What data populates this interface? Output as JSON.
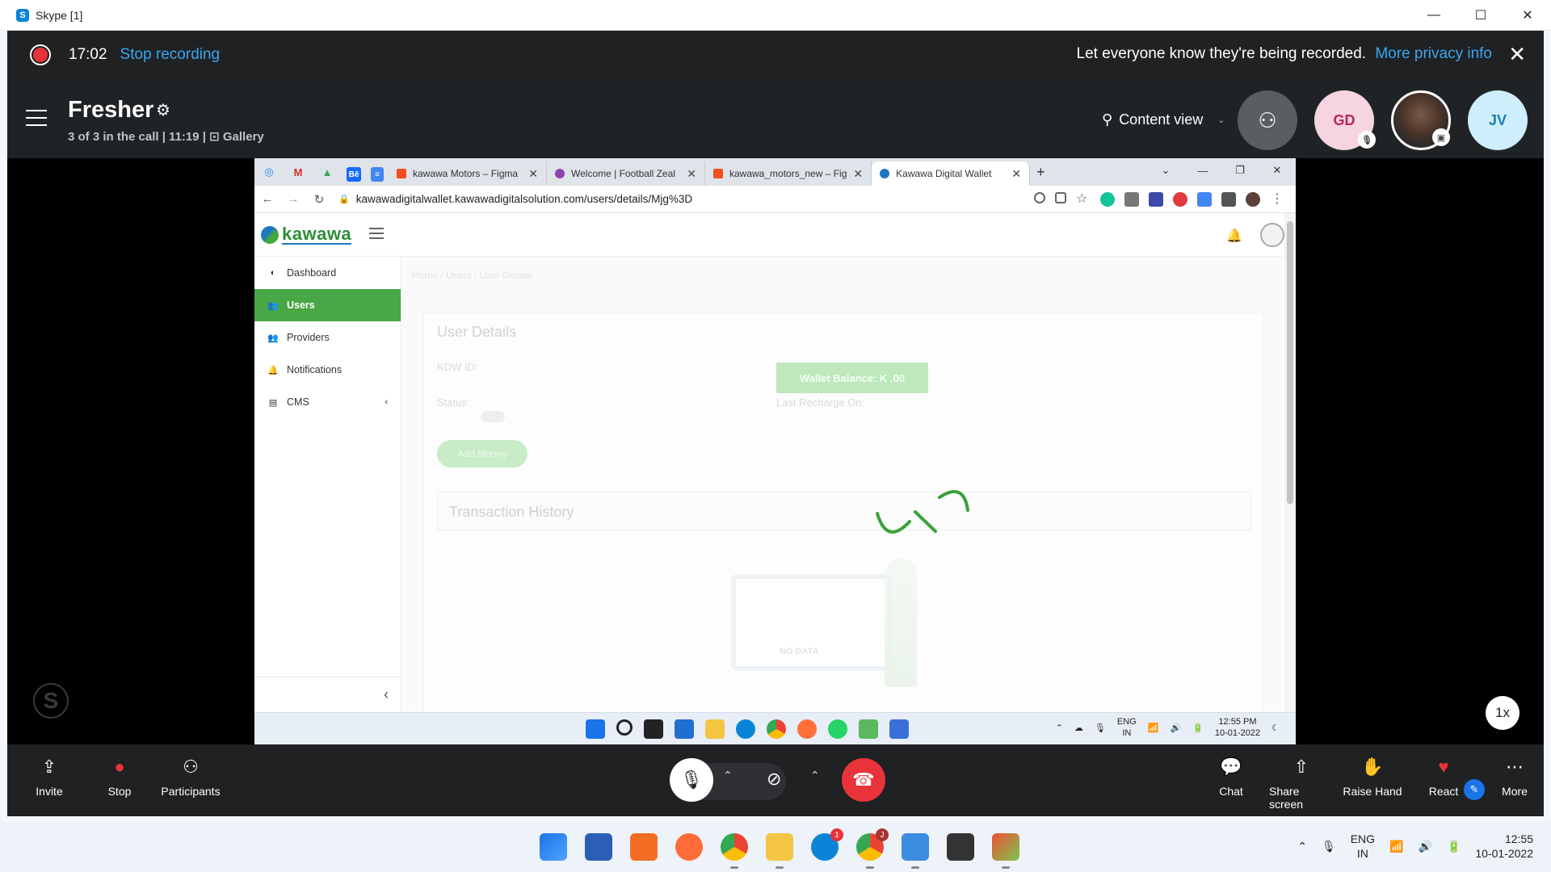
{
  "window": {
    "title": "Skype [1]",
    "minimize": "—",
    "maximize": "☐",
    "close": "✕"
  },
  "recording": {
    "time": "17:02",
    "stop_label": "Stop recording",
    "message": "Let everyone know they're being recorded.",
    "privacy_link": "More privacy info",
    "close": "✕"
  },
  "call": {
    "name": "Fresher",
    "subtitle": "3 of 3 in the call | 11:19 | ⊡ Gallery",
    "content_view": "Content view",
    "participants": [
      {
        "initials": "GD",
        "muted": true
      },
      {
        "initials": "",
        "photo": true
      },
      {
        "initials": "JV"
      }
    ],
    "zoom": "1x"
  },
  "browser": {
    "tabs": [
      {
        "label": "kawawa Motors – Figma",
        "fav": "#f24e1e"
      },
      {
        "label": "Welcome | Football Zeal",
        "fav": "#8e44ad"
      },
      {
        "label": "kawawa_motors_new – Fig",
        "fav": "#f24e1e"
      },
      {
        "label": "Kawawa Digital Wallet",
        "fav": "#1f76c2",
        "active": true
      }
    ],
    "new_tab": "+",
    "url": "kawawadigitalwallet.kawawadigitalsolution.com/users/details/Mjg%3D"
  },
  "webapp": {
    "logo": "kawawa",
    "sidebar": [
      {
        "icon": "◐",
        "label": "Dashboard"
      },
      {
        "icon": "👥",
        "label": "Users",
        "active": true
      },
      {
        "icon": "👥",
        "label": "Providers"
      },
      {
        "icon": "🔔",
        "label": "Notifications"
      },
      {
        "icon": "▤",
        "label": "CMS",
        "chevron": "‹"
      }
    ],
    "collapse": "‹",
    "breadcrumb": "Home   /  Users   /  User Details",
    "card_title": "User Details",
    "kdw_label": "KDW ID:",
    "status_label": "Status:",
    "wallet_balance": "Wallet Balance: K .00",
    "last_recharge": "Last Recharge On:",
    "add_money": "Add Money",
    "tx_title": "Transaction History",
    "no_data": "NO DATA"
  },
  "inner_taskbar": {
    "lang": "ENG",
    "region": "IN",
    "time": "12:55 PM",
    "date": "10-01-2022"
  },
  "toolbar": {
    "invite": "Invite",
    "stop": "Stop",
    "participants": "Participants",
    "chat": "Chat",
    "share_screen": "Share screen",
    "raise_hand": "Raise Hand",
    "react": "React",
    "more": "More"
  },
  "taskbar": {
    "skype_badge": "1",
    "chrome_badge": "J",
    "lang": "ENG",
    "region": "IN",
    "time": "12:55",
    "date": "10-01-2022"
  }
}
